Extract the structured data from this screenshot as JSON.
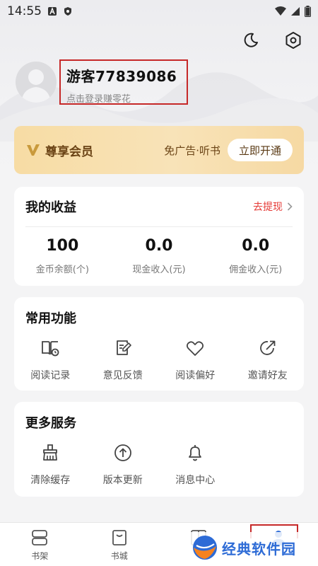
{
  "status_bar": {
    "time": "14:55"
  },
  "profile": {
    "username": "游客77839086",
    "login_hint": "点击登录赚零花"
  },
  "vip": {
    "title": "尊享会员",
    "perks": "免广告·听书",
    "button": "立即开通"
  },
  "earnings": {
    "title": "我的收益",
    "withdraw": "去提现",
    "stats": [
      {
        "value": "100",
        "label": "金币余额(个)"
      },
      {
        "value": "0.0",
        "label": "现金收入(元)"
      },
      {
        "value": "0.0",
        "label": "佣金收入(元)"
      }
    ]
  },
  "functions": {
    "title": "常用功能",
    "items": [
      {
        "label": "阅读记录",
        "icon": "reading-record-icon"
      },
      {
        "label": "意见反馈",
        "icon": "feedback-icon"
      },
      {
        "label": "阅读偏好",
        "icon": "heart-icon"
      },
      {
        "label": "邀请好友",
        "icon": "invite-icon"
      }
    ]
  },
  "services": {
    "title": "更多服务",
    "items": [
      {
        "label": "清除缓存",
        "icon": "broom-icon"
      },
      {
        "label": "版本更新",
        "icon": "cloud-upload-icon"
      },
      {
        "label": "消息中心",
        "icon": "bell-icon"
      }
    ]
  },
  "bottom_nav": {
    "items": [
      {
        "label": "书架",
        "icon": "bookshelf-icon"
      },
      {
        "label": "书城",
        "icon": "bookstore-icon"
      },
      {
        "label": "",
        "icon": "category-icon"
      },
      {
        "label": "",
        "icon": "profile-icon"
      }
    ]
  },
  "watermark": {
    "text": "经典软件园"
  },
  "colors": {
    "accent_red": "#e53935",
    "vip_gold": "#f7dca4",
    "vip_text": "#6b4416"
  }
}
